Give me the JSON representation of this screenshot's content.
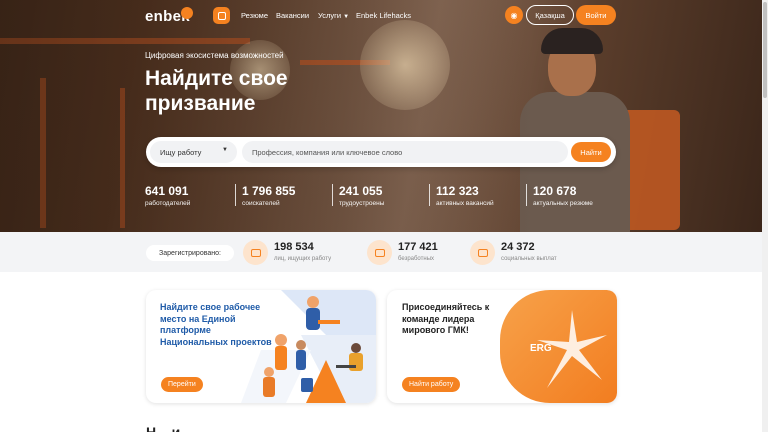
{
  "brand": {
    "logo_text": "enbek",
    "accent_color": "#f58220",
    "title_blue": "#1f5ba8"
  },
  "nav": {
    "menu_icon": "grid-icon",
    "links": [
      {
        "label": "Резюме"
      },
      {
        "label": "Вакансии"
      },
      {
        "label": "Услуги",
        "has_dropdown": true
      },
      {
        "label": "Enbek Lifehacks"
      }
    ],
    "accessibility_icon": "eye-icon",
    "language_button": "Қазақша",
    "login_button": "Войти"
  },
  "hero": {
    "eyebrow": "Цифровая экосистема возможностей",
    "headline": "Найдите свое призвание"
  },
  "search": {
    "type_selected": "Ищу работу",
    "placeholder": "Профессия, компания или ключевое слово",
    "button": "Найти"
  },
  "stats": [
    {
      "value": "641 091",
      "label": "работодателей"
    },
    {
      "value": "1 796 855",
      "label": "соискателей"
    },
    {
      "value": "241 055",
      "label": "трудоустроены"
    },
    {
      "value": "112 323",
      "label": "активных вакансий"
    },
    {
      "value": "120 678",
      "label": "актуальных резюме"
    }
  ],
  "registered": {
    "label": "Зарегистрировано:",
    "items": [
      {
        "icon": "briefcase-icon",
        "value": "198 534",
        "label": "лиц, ищущих работу"
      },
      {
        "icon": "people-icon",
        "value": "177 421",
        "label": "безработных"
      },
      {
        "icon": "wallet-icon",
        "value": "24 372",
        "label": "социальных выплат"
      }
    ]
  },
  "promos": [
    {
      "title": "Найдите свое рабочее место на Единой платформе Национальных проектов",
      "button": "Перейти"
    },
    {
      "title": "Присоединяйтесь к команде лидера мирового ГМК!",
      "button": "Найти работу",
      "logo_text": "ERG"
    }
  ],
  "section_heading": "Н... и..."
}
